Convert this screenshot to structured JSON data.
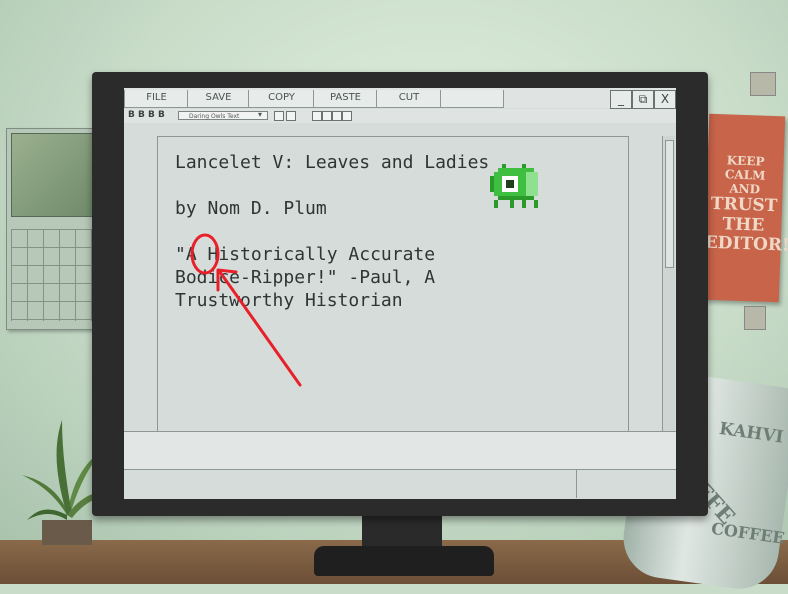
{
  "menu": {
    "file": "FILE",
    "save": "SAVE",
    "copy": "COPY",
    "paste": "PASTE",
    "cut": "CUT"
  },
  "window_controls": {
    "minimize": "_",
    "restore": "⧉",
    "close": "X"
  },
  "toolbar": {
    "format_buttons": [
      "B",
      "B",
      "B",
      "B"
    ],
    "font_name": "Daring Owls Text"
  },
  "document": {
    "title_line": "Lancelet V: Leaves and Ladies",
    "author_line": "by Nom D. Plum",
    "quote_line_1": "\"A Historically Accurate",
    "quote_line_2": "Bodice-Ripper!\" -Paul, A",
    "quote_line_3": "Trustworthy Historian"
  },
  "poster": {
    "line1": "KEEP",
    "line2": "CALM",
    "line3": "AND",
    "line4": "TRUST",
    "line5": "THE",
    "line6": "EDITOR!"
  },
  "mug": {
    "word1": "KAHVI",
    "word2": "KAFFE",
    "word3": "COFFEE"
  },
  "colors": {
    "annotation": "#e8202a",
    "bug_green": "#3fbf3f",
    "poster_red": "#c8644a"
  }
}
